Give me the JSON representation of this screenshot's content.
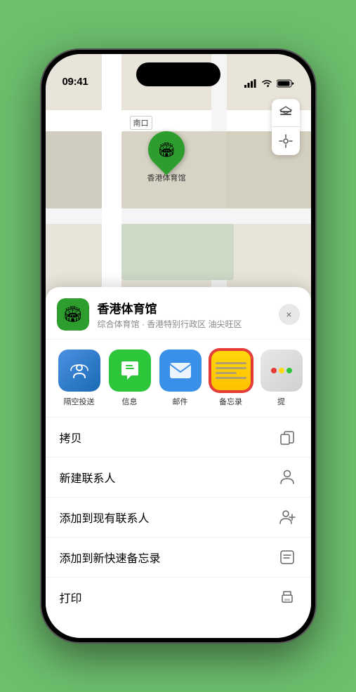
{
  "statusBar": {
    "time": "09:41",
    "locationIcon": true
  },
  "map": {
    "label_nankou": "南口"
  },
  "marker": {
    "label": "香港体育馆"
  },
  "sheet": {
    "venueName": "香港体育馆",
    "venueSub": "综合体育馆 · 香港特别行政区 油尖旺区",
    "closeLabel": "×"
  },
  "shareItems": [
    {
      "id": "airdrop",
      "label": "隔空投送",
      "type": "airdrop"
    },
    {
      "id": "messages",
      "label": "信息",
      "type": "messages"
    },
    {
      "id": "mail",
      "label": "邮件",
      "type": "mail"
    },
    {
      "id": "notes",
      "label": "备忘录",
      "type": "notes"
    },
    {
      "id": "more",
      "label": "提",
      "type": "more"
    }
  ],
  "actions": [
    {
      "id": "copy",
      "text": "拷贝",
      "icon": "copy"
    },
    {
      "id": "new-contact",
      "text": "新建联系人",
      "icon": "person"
    },
    {
      "id": "add-to-contact",
      "text": "添加到现有联系人",
      "icon": "person-add"
    },
    {
      "id": "add-to-notes",
      "text": "添加到新快速备忘录",
      "icon": "note"
    },
    {
      "id": "print",
      "text": "打印",
      "icon": "print"
    }
  ]
}
